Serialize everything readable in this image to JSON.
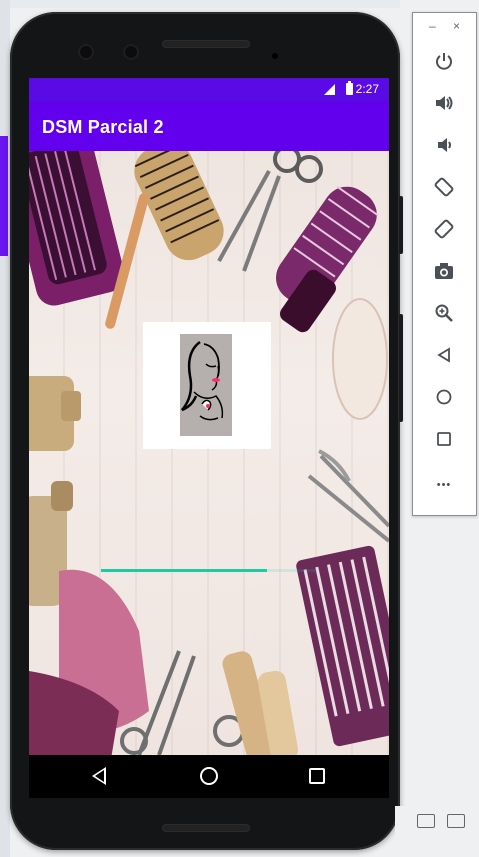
{
  "app": {
    "title": "DSM Parcial 2"
  },
  "status_bar": {
    "time": "2:27",
    "signal_icon": "signal-icon",
    "battery_icon": "battery-icon"
  },
  "progress": {
    "value": 0.77
  },
  "navbar": {
    "back_icon": "back-triangle-icon",
    "home_icon": "home-circle-icon",
    "recents_icon": "recents-square-icon"
  },
  "emulator_toolbar": {
    "minimize_label": "–",
    "close_label": "×",
    "more_label": "•••",
    "tools": [
      {
        "name": "power-icon"
      },
      {
        "name": "volume-up-icon"
      },
      {
        "name": "volume-down-icon"
      },
      {
        "name": "rotate-left-icon"
      },
      {
        "name": "rotate-right-icon"
      },
      {
        "name": "camera-icon"
      },
      {
        "name": "zoom-icon"
      },
      {
        "name": "back-icon"
      },
      {
        "name": "home-icon"
      },
      {
        "name": "overview-icon"
      },
      {
        "name": "more-icon"
      }
    ]
  },
  "colors": {
    "status_bar": "#5a0be5",
    "app_bar": "#6200ee",
    "progress": "#1ec9a8",
    "lipstick": "#ff2a6a"
  }
}
